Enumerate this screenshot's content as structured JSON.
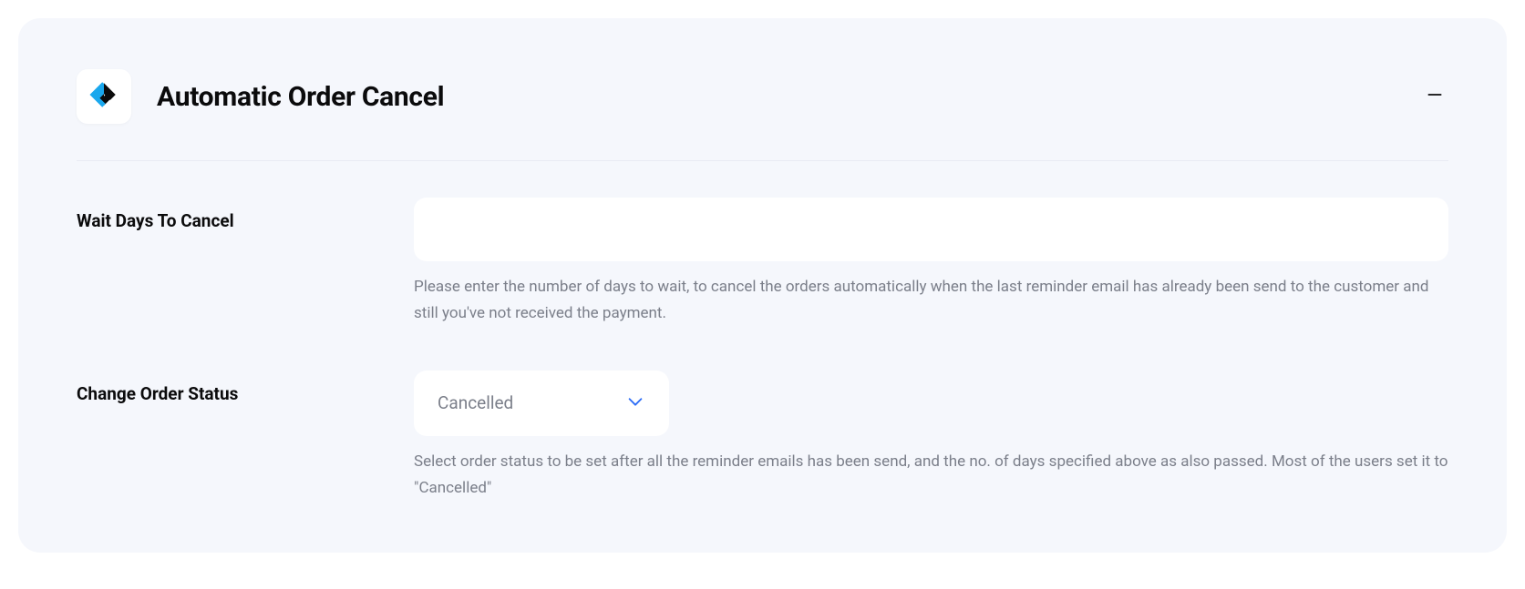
{
  "panel": {
    "title": "Automatic Order Cancel",
    "icon_name": "app-logo"
  },
  "fields": {
    "wait_days": {
      "label": "Wait Days To Cancel",
      "value": "",
      "help": "Please enter the number of days to wait, to cancel the orders automatically when the last reminder email has already been send to the customer and still you've not received the payment."
    },
    "order_status": {
      "label": "Change Order Status",
      "selected": "Cancelled",
      "help": "Select order status to be set after all the reminder emails has been send, and the no. of days specified above as also passed. Most of the users set it to \"Cancelled\""
    }
  }
}
